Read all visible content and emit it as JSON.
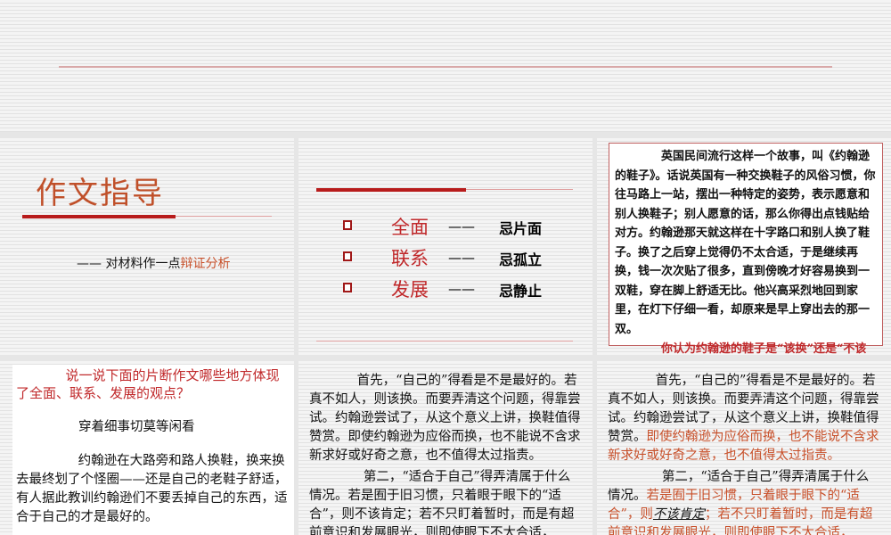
{
  "slide1": {},
  "slide2": {
    "title": "作文指导",
    "subtitle_prefix": "—— 对材料作一点",
    "subtitle_highlight": "辩证分析"
  },
  "slide3": {
    "items": [
      {
        "term": "全面",
        "dash": "——",
        "avoid": "忌片面"
      },
      {
        "term": "联系",
        "dash": "——",
        "avoid": "忌孤立"
      },
      {
        "term": "发展",
        "dash": "——",
        "avoid": "忌静止"
      }
    ]
  },
  "slide4": {
    "story": "英国民间流行这样一个故事，叫《约翰逊的鞋子》。话说英国有一种交换鞋子的风俗习惯，你往马路上一站，摆出一种特定的姿势，表示愿意和别人换鞋子；别人愿意的话，那么你得出点钱贴给对方。约翰逊那天就这样在十字路口和别人换了鞋子。换了之后穿上觉得仍不太合适，于是继续再换，钱一次次贴了很多，直到傍晚才好容易换到一双鞋，穿在脚上舒适无比。他兴高采烈地回到家里，在灯下仔细一看，却原来是早上穿出去的那一双。",
    "question": "你认为约翰逊的鞋子是“该换”还是“不该换”？并且简要地说明理由。"
  },
  "slide5": {
    "prompt": "说一说下面的片断作文哪些地方体现了全面、联系、发展的观点？",
    "heading": "穿着细事切莫等闲看",
    "body": "约翰逊在大路旁和路人换鞋，换来换去最终划了个怪圈——还是自己的老鞋子舒适，有人据此教训约翰逊们不要丢掉自己的东西，适合于自己的才是最好的。"
  },
  "slide6": {
    "p1": "首先，“自己的”得看是不是最好的。若真不如人，则该换。而要弄清这个问题，得靠尝试。约翰逊尝试了，从这个意义上讲，换鞋值得赞赏。即使约翰逊为应俗而换，也不能说不含求新求好或好奇之意，也不值得太过指责。",
    "p2": "第二，“适合于自己”得弄清属于什么情况。若是囿于旧习惯，只着眼于眼下的“适合”，则不该肯定；若不只盯着暂时，而是有超前意识和发展眼光，则即使眼下不大合适，"
  },
  "slide7": {
    "p1a": "首先，“自己的”得看是不是最好的。若真不如人，则该换。而要弄清这个问题，得靠尝试。约翰逊尝试了，从这个意义上讲，换鞋值得赞赏。",
    "p1b": "即使约翰逊为应俗而换，也不能说不含求新求好或好奇之意，也不值得太过指责。",
    "p2a": "第二，“适合于自己”得弄清属于什么情况。",
    "p2b": "若是囿于旧习惯，只着眼于眼下的“适合”，则",
    "p2c": "不该肯定",
    "p2d": "；若不只盯着暂时，而是有超前意识和发展眼光，则即使眼下不大合适，"
  }
}
